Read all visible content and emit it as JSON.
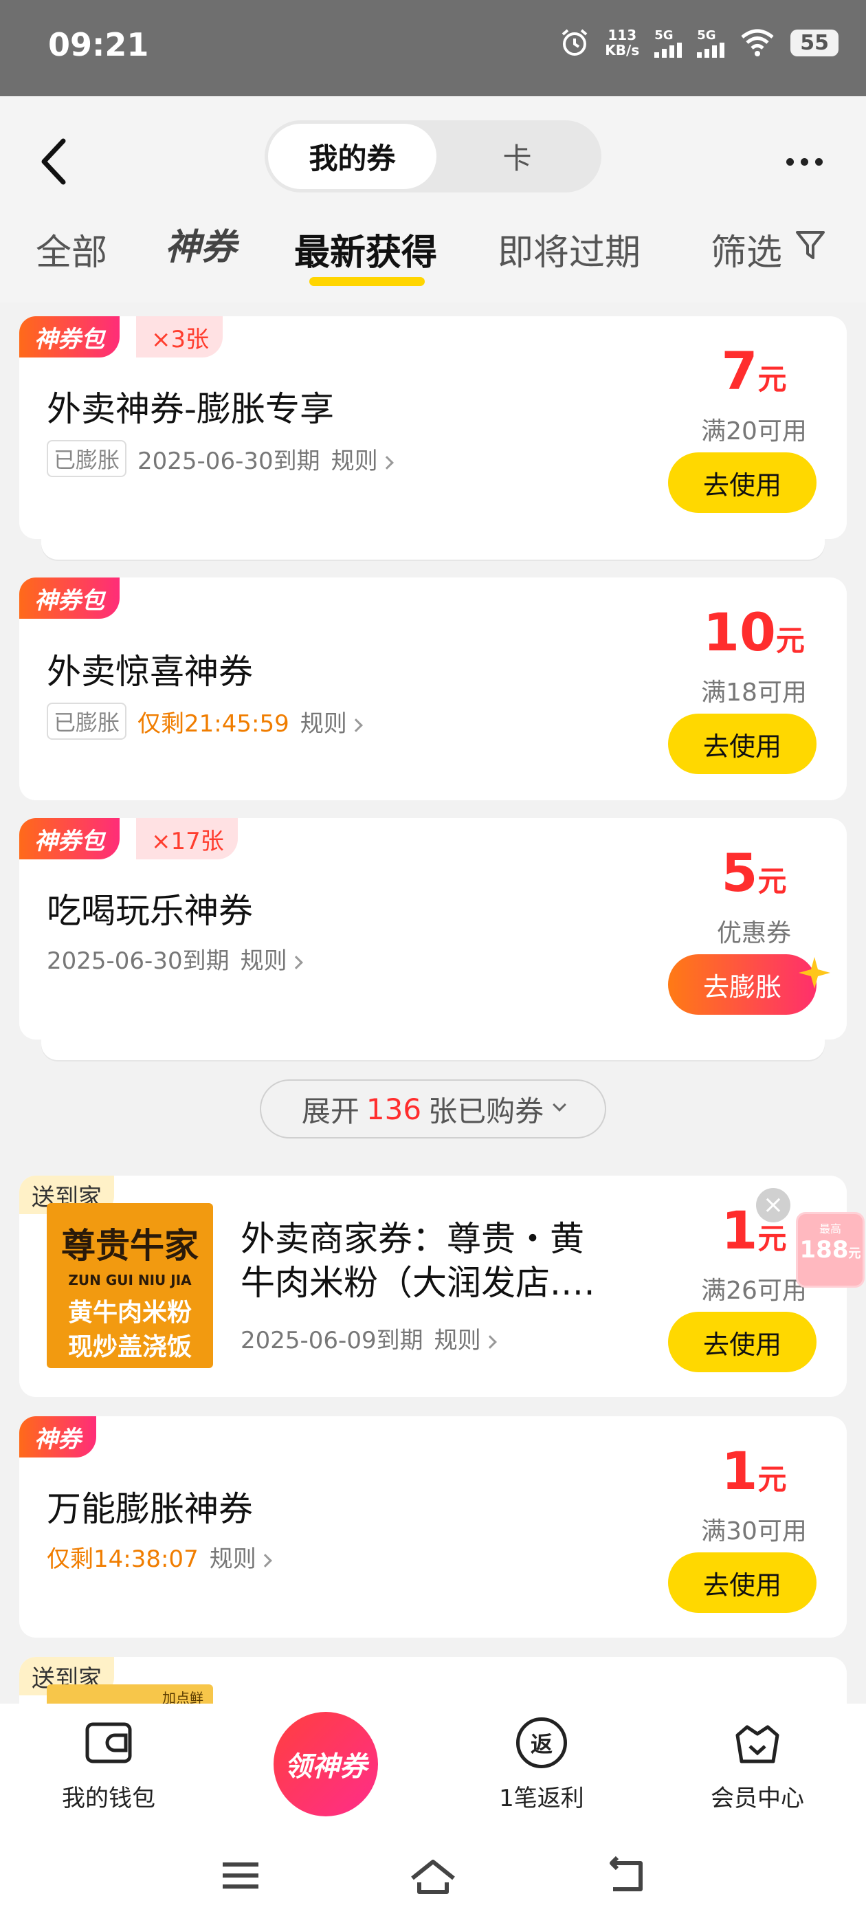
{
  "status_bar": {
    "time": "09:21",
    "net_speed_value": "113",
    "net_speed_unit": "KB/s",
    "sim1": "5G",
    "sim2": "5G",
    "battery": "55"
  },
  "header": {
    "segment_active": "我的券",
    "segment_inactive": "卡",
    "tabs": [
      {
        "label": "全部"
      },
      {
        "label": "神券"
      },
      {
        "label": "最新获得",
        "active": true
      },
      {
        "label": "即将过期"
      },
      {
        "label": "筛选"
      }
    ]
  },
  "coupons": [
    {
      "tag": "神券包",
      "count": "×3张",
      "title": "外卖神券-膨胀专享",
      "badge": "已膨胀",
      "expiry": "2025-06-30到期",
      "rules": "规则",
      "amount": "7",
      "unit": "元",
      "condition": "满20可用",
      "button": "去使用"
    },
    {
      "tag": "神券包",
      "title": "外卖惊喜神券",
      "badge": "已膨胀",
      "countdown": "仅剩21:45:59",
      "rules": "规则",
      "amount": "10",
      "unit": "元",
      "condition": "满18可用",
      "button": "去使用"
    },
    {
      "tag": "神券包",
      "count": "×17张",
      "title": "吃喝玩乐神券",
      "expiry": "2025-06-30到期",
      "rules": "规则",
      "amount": "5",
      "unit": "元",
      "condition": "优惠券",
      "button": "去膨胀"
    }
  ],
  "expand": {
    "prefix": "展开",
    "count": "136",
    "suffix": "张已购券"
  },
  "merchant_coupon": {
    "tag": "送到家",
    "logo_title": "尊贵牛家",
    "logo_sub": "ZUN GUI NIU JIA",
    "logo_line1": "黄牛肉米粉",
    "logo_line2": "现炒盖浇饭",
    "title": "外卖商家券：尊贵・黄牛肉米粉（大润发店.…",
    "expiry": "2025-06-09到期",
    "rules": "规则",
    "amount": "1",
    "unit": "元",
    "condition": "满26可用",
    "button": "去使用",
    "close": "×"
  },
  "float_badge": {
    "small": "最高",
    "big": "188",
    "unit": "元"
  },
  "universal_coupon": {
    "tag": "神券",
    "title": "万能膨胀神券",
    "countdown": "仅剩14:38:07",
    "rules": "规则",
    "amount": "1",
    "unit": "元",
    "condition": "满30可用",
    "button": "去使用"
  },
  "partial_coupon": {
    "tag": "送到家",
    "logo_partial": "加点鲜"
  },
  "bottom_nav": {
    "wallet": "我的钱包",
    "center": "领神券",
    "rebate_icon": "返",
    "rebate": "1笔返利",
    "member": "会员中心"
  },
  "icons": {
    "back": "chevron-left-icon",
    "more": "more-icon",
    "filter": "filter-icon",
    "wallet": "wallet-icon",
    "member": "crown-bag-icon"
  },
  "colors": {
    "accent_yellow": "#ffd800",
    "price_red": "#ff2d2d",
    "countdown_orange": "#f07d00",
    "tag_gradient_start": "#ff6a1a",
    "tag_gradient_end": "#ff2d78"
  }
}
